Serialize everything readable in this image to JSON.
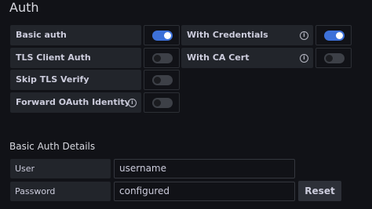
{
  "section_title": "Auth",
  "toggles": [
    {
      "label": "Basic auth",
      "state": "on"
    },
    {
      "label": "With Credentials",
      "state": "on",
      "info_icon": "info-icon"
    },
    {
      "label": "TLS Client Auth",
      "state": "off"
    },
    {
      "label": "With CA Cert",
      "state": "off",
      "info_icon": "info-icon"
    },
    {
      "label": "Skip TLS Verify",
      "state": "off"
    },
    {
      "label": "Forward OAuth Identity",
      "state": "off",
      "info_icon": "info-icon"
    }
  ],
  "basic_auth_details": {
    "title": "Basic Auth Details",
    "user_label": "User",
    "user_value": "username",
    "password_label": "Password",
    "password_value": "configured",
    "reset_label": "Reset"
  },
  "colors": {
    "background": "#111217",
    "label_bg": "#22252b",
    "toggle_on": "#3d71d9",
    "toggle_off": "#3d4047"
  }
}
